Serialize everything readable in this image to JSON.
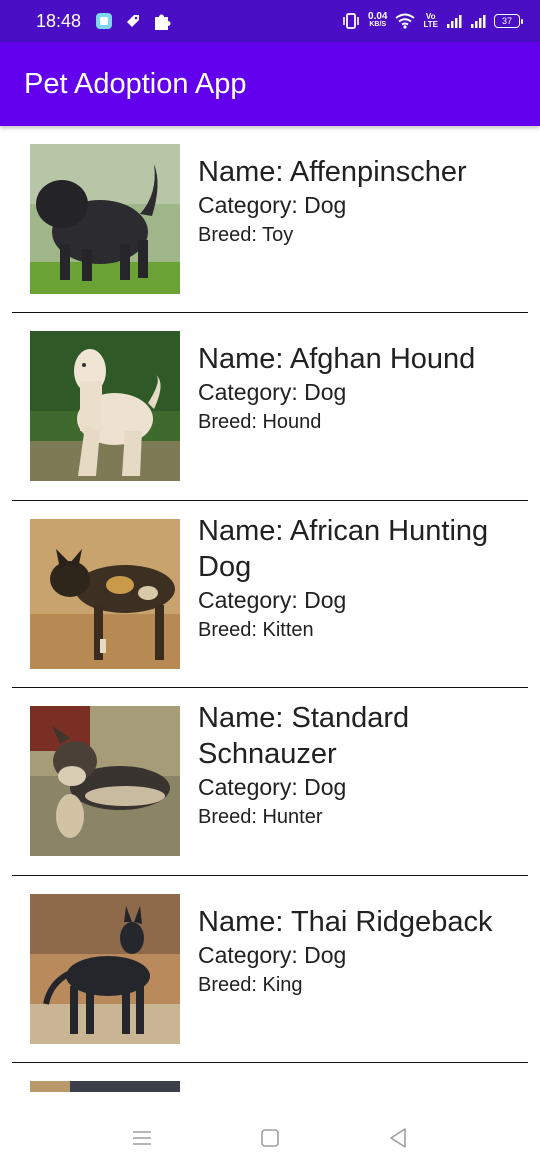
{
  "status_bar": {
    "time": "18:48",
    "net_speed": "0.04",
    "net_unit": "KB/S",
    "volte_top": "Vo",
    "volte_bottom": "LTE",
    "battery": "37",
    "background": "#4a0fc4"
  },
  "app_bar": {
    "title": "Pet Adoption App",
    "color": "#6200ee"
  },
  "pets": [
    {
      "name": "Name: Affenpinscher",
      "category": "Category: Dog",
      "breed": "Breed: Toy",
      "photo": "affenpinscher-photo"
    },
    {
      "name": "Name: Afghan Hound",
      "category": "Category: Dog",
      "breed": "Breed: Hound",
      "photo": "afghan-hound-photo"
    },
    {
      "name": "Name: African Hunting Dog",
      "category": "Category: Dog",
      "breed": "Breed: Kitten",
      "photo": "african-hunting-dog-photo"
    },
    {
      "name": "Name: Standard Schnauzer",
      "category": "Category: Dog",
      "breed": "Breed: Hunter",
      "photo": "standard-schnauzer-photo"
    },
    {
      "name": "Name: Thai Ridgeback",
      "category": "Category: Dog",
      "breed": "Breed: King",
      "photo": "thai-ridgeback-photo"
    }
  ],
  "nav_bar": {
    "icons": [
      "menu-icon",
      "home-square-icon",
      "back-triangle-icon"
    ]
  }
}
